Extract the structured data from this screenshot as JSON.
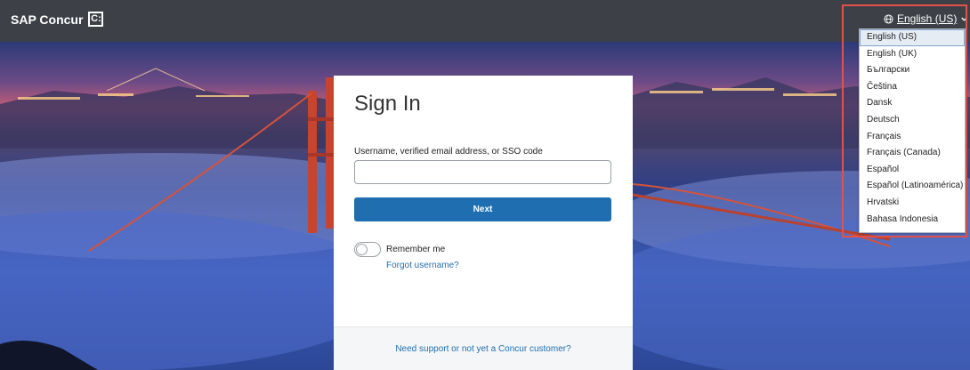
{
  "header": {
    "brand_name": "SAP Concur",
    "brand_mark": "C:",
    "language_current": "English (US)",
    "globe_icon": "globe-icon",
    "chevron_icon": "chevron-down-icon"
  },
  "signin": {
    "title": "Sign In",
    "username_label": "Username, verified email address, or SSO code",
    "username_value": "",
    "username_placeholder": "",
    "next_label": "Next",
    "remember_label": "Remember me",
    "remember_on": false,
    "forgot_label": "Forgot username?",
    "support_label": "Need support or not yet a Concur customer?"
  },
  "language_options": [
    "English (US)",
    "English (UK)",
    "Български",
    "Čeština",
    "Dansk",
    "Deutsch",
    "Français",
    "Français (Canada)",
    "Español",
    "Español (Latinoamérica)",
    "Hrvatski",
    "Bahasa Indonesia"
  ],
  "language_selected": "English (US)",
  "colors": {
    "topbar": "#3d4147",
    "accent": "#1f6eb0",
    "highlight": "#e4514a"
  }
}
